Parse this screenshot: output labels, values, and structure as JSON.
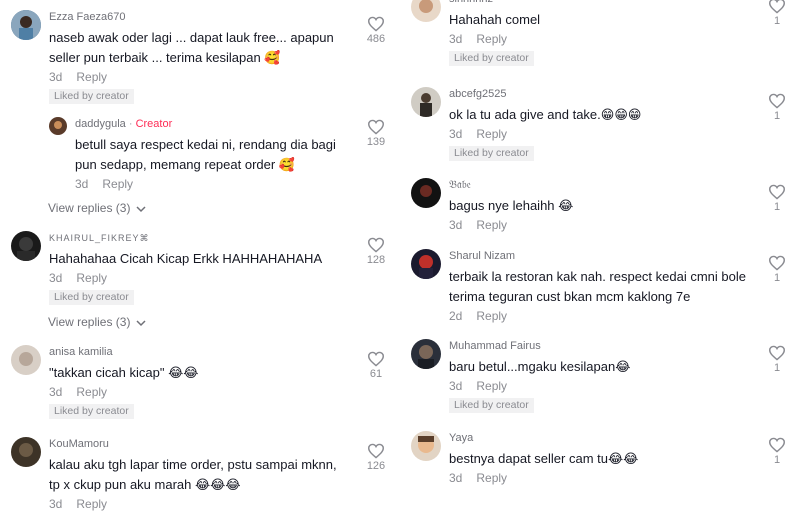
{
  "left": {
    "comments": [
      {
        "user": "Ezza Faeza670",
        "text": "naseb awak oder lagi ... dapat lauk free... apapun seller pun terbaik ... terima kesilapan 🥰",
        "time": "3d",
        "reply": "Reply",
        "liked": "Liked by creator",
        "likes": "486"
      },
      {
        "user": "KHAIRUL_FIKREY⌘",
        "text": "Hahahahaa Cicah Kicap Erkk HAHHAHAHAHA",
        "time": "3d",
        "reply": "Reply",
        "liked": "Liked by creator",
        "likes": "128"
      },
      {
        "user": "anisa kamilia",
        "text": "\"takkan cicah kicap\" 😂😂",
        "time": "3d",
        "reply": "Reply",
        "liked": "Liked by creator",
        "likes": "61"
      },
      {
        "user": "KouMamoru",
        "text": "kalau aku tgh lapar time order, pstu sampai mknn, tp x ckup pun aku marah 😂😂😂",
        "time": "3d",
        "reply": "Reply",
        "likes": "126"
      }
    ],
    "reply": {
      "user": "daddygula",
      "creator": "Creator",
      "text": "betull saya respect kedai ni, rendang dia bagi pun sedapp, memang repeat order 🥰",
      "time": "3d",
      "reply": "Reply",
      "likes": "139"
    },
    "view_replies_1": "View replies (3)",
    "view_replies_2": "View replies (3)"
  },
  "right": {
    "comments": [
      {
        "user": "sinnnnnz",
        "text": "Hahahah comel",
        "time": "3d",
        "reply": "Reply",
        "liked": "Liked by creator",
        "likes": "1"
      },
      {
        "user": "abcefg2525",
        "text": "ok la tu ada give and take.😁😁😁",
        "time": "3d",
        "reply": "Reply",
        "liked": "Liked by creator",
        "likes": "1"
      },
      {
        "user": "𝔅𝔞𝔟𝔢",
        "text": "bagus nye lehaihh 😂",
        "time": "3d",
        "reply": "Reply",
        "likes": "1"
      },
      {
        "user": "Sharul Nizam",
        "text": "terbaik la restoran kak nah. respect kedai cmni bole terima teguran cust bkan mcm kaklong 7e",
        "time": "2d",
        "reply": "Reply",
        "likes": "1"
      },
      {
        "user": "Muhammad Fairus",
        "text": "baru betul...mgaku kesilapan😂",
        "time": "3d",
        "reply": "Reply",
        "liked": "Liked by creator",
        "likes": "1"
      },
      {
        "user": "Yaya",
        "text": "bestnya dapat seller cam tu😂😂",
        "time": "3d",
        "reply": "Reply",
        "likes": "1"
      }
    ]
  },
  "colors": {
    "creator": "#fe2c55",
    "muted": "#8a8b91",
    "text": "#161823",
    "badge_bg": "#f1f1f2"
  },
  "icons": {
    "like": "heart-outline-icon",
    "chevron": "chevron-down-icon"
  }
}
